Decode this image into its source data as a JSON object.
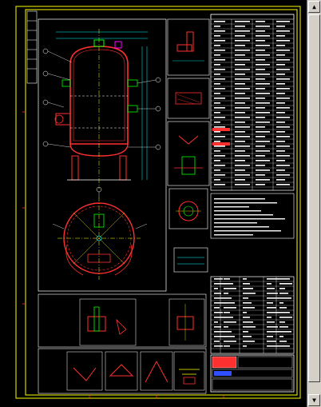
{
  "drawing": {
    "title_block": {
      "row1": "",
      "row2": "",
      "row3": ""
    }
  },
  "viewer": {
    "scroll_up_glyph": "▲",
    "scroll_down_glyph": "▼"
  },
  "colors": {
    "paper": "#000000",
    "frame": "#ffff00",
    "outline": "#ffffff",
    "vessel": "#ff3030",
    "dimension": "#00ffff",
    "center_line": "#ffff00",
    "detail": "#00ff00",
    "nozzle": "#ff00ff"
  }
}
